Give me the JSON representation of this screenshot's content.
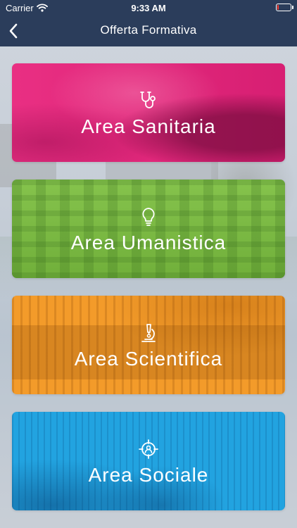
{
  "status_bar": {
    "carrier": "Carrier",
    "time": "9:33 AM",
    "wifi_icon": "wifi-icon",
    "battery_icon": "battery-low-icon",
    "battery_level": 0.1,
    "battery_color": "#ff3b30"
  },
  "nav": {
    "title": "Offerta Formativa",
    "back_icon": "chevron-left-icon",
    "background": "#2b3d5b"
  },
  "areas": [
    {
      "label": "Area Sanitaria",
      "icon": "stethoscope-icon",
      "color": "#e8247c"
    },
    {
      "label": "Area Umanistica",
      "icon": "lightbulb-icon",
      "color": "#7fc043"
    },
    {
      "label": "Area Scientifica",
      "icon": "microscope-icon",
      "color": "#f39b2a"
    },
    {
      "label": "Area Sociale",
      "icon": "target-user-icon",
      "color": "#22a3e0"
    }
  ]
}
